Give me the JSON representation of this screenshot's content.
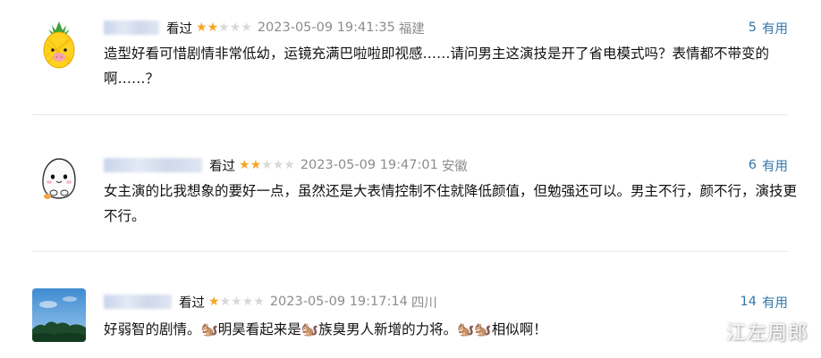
{
  "reviews": [
    {
      "status": "看过",
      "rating": 2,
      "time": "2023-05-09 19:41:35",
      "location": "福建",
      "votes": "5",
      "vote_label": "有用",
      "content": "造型好看可惜剧情非常低幼，运镜充满巴啦啦即视感……请问男主这演技是开了省电模式吗？表情都不带变的啊……？",
      "avatar_icon": "pineapple-avatar-icon"
    },
    {
      "status": "看过",
      "rating": 2,
      "time": "2023-05-09 19:47:01",
      "location": "安徽",
      "votes": "6",
      "vote_label": "有用",
      "content": "女主演的比我想象的要好一点，虽然还是大表情控制不住就降低颜值，但勉强还可以。男主不行，颜不行，演技更不行。",
      "avatar_icon": "mochi-ghost-avatar-icon"
    },
    {
      "status": "看过",
      "rating": 1,
      "time": "2023-05-09 19:17:14",
      "location": "四川",
      "votes": "14",
      "vote_label": "有用",
      "content": "好弱智的剧情。🐿️明昊看起来是🐿️族臭男人新增的力将。🐿️🐿️相似啊！",
      "avatar_icon": "sky-photo-avatar-icon"
    }
  ],
  "colors": {
    "star_on": "#f5a623",
    "star_off": "#d8d8d8",
    "link": "#3377aa",
    "muted": "#8c8c8c"
  },
  "watermark": "江左周郎"
}
